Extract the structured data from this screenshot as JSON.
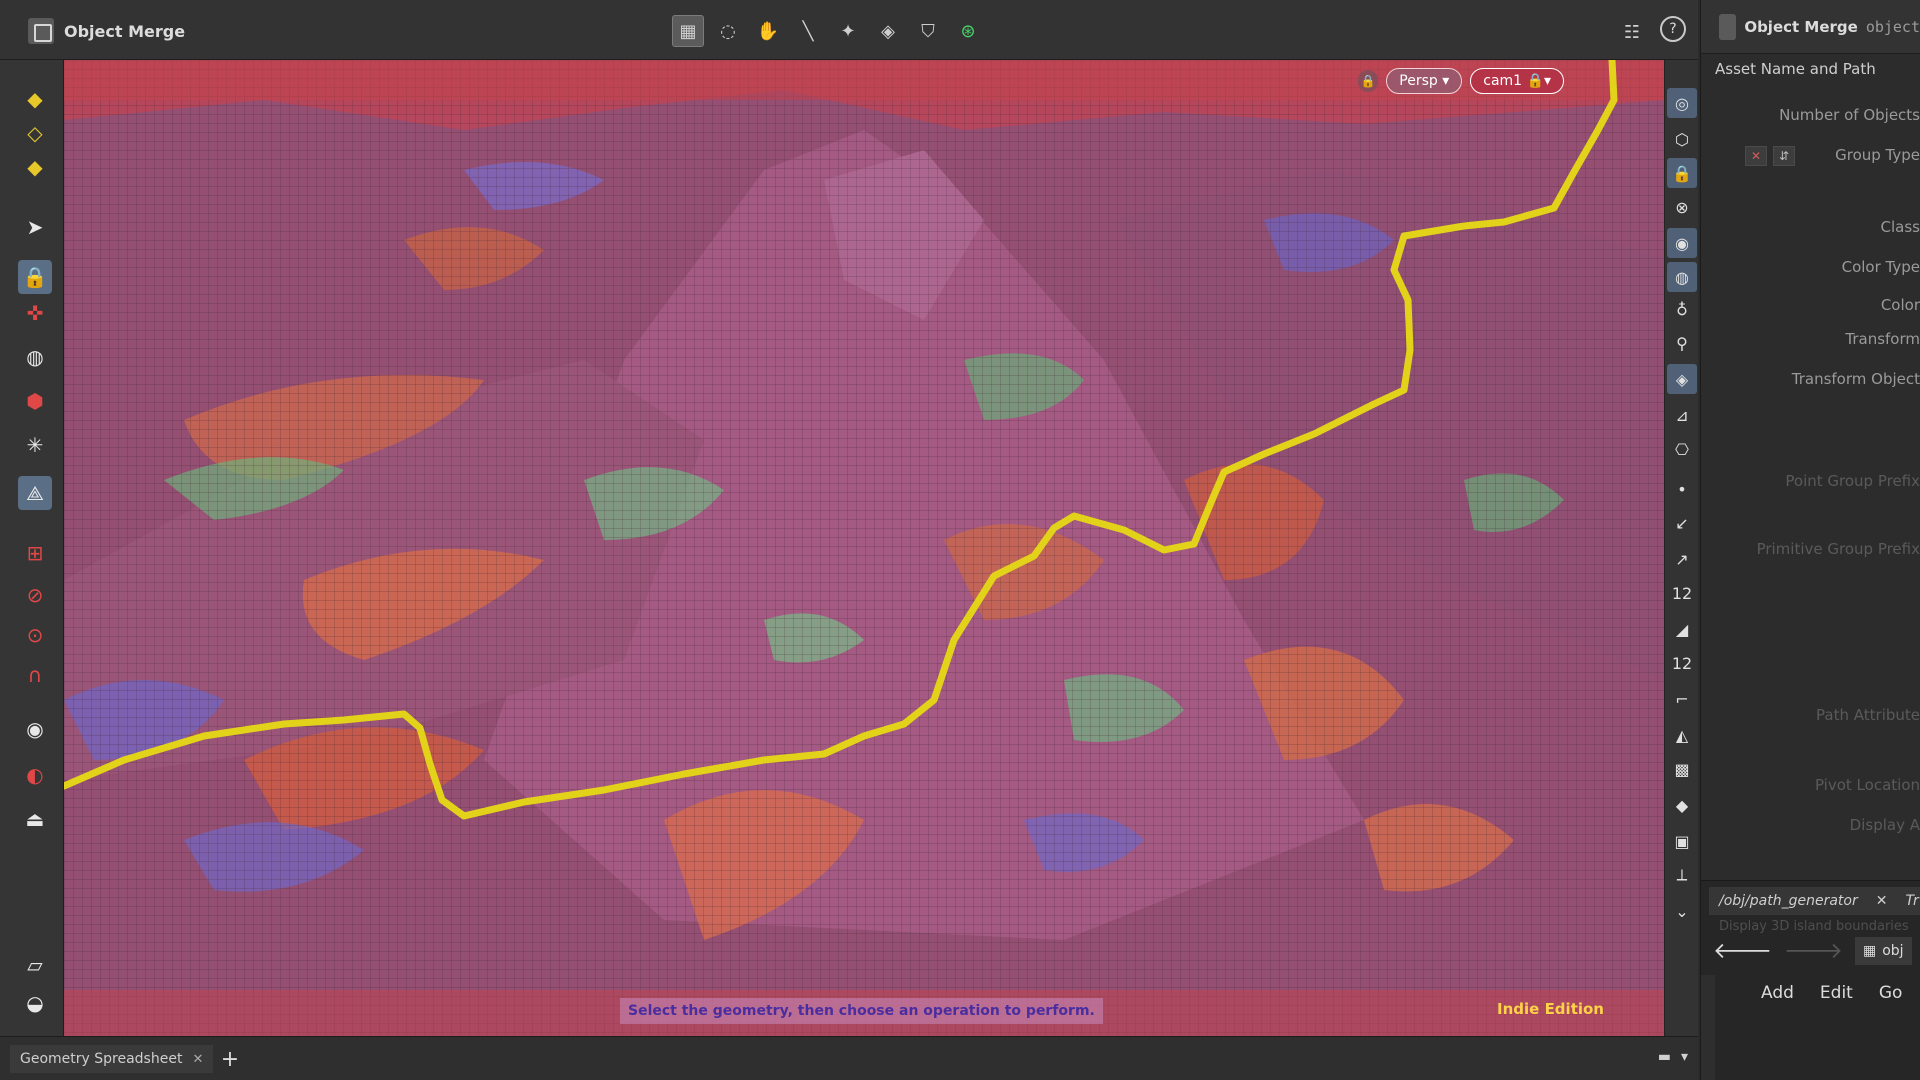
{
  "window": {
    "title": "Object Merge"
  },
  "viewport": {
    "view_mode": "Persp",
    "camera": "cam1",
    "status_message": "Select the geometry, then choose an operation to perform.",
    "edition": "Indie Edition"
  },
  "bottom_pane": {
    "tab_label": "Geometry Spreadsheet"
  },
  "params": {
    "header_title": "Object Merge",
    "header_node": "object",
    "section_label": "Asset Name and Path",
    "fields": [
      {
        "label": "Number of Objects"
      },
      {
        "label": "Group Type"
      },
      {
        "label": "Class"
      },
      {
        "label": "Color Type"
      },
      {
        "label": "Color"
      },
      {
        "label": "Transform"
      },
      {
        "label": "Transform Object"
      },
      {
        "label": "Point Group Prefix"
      },
      {
        "label": "Primitive Group Prefix"
      },
      {
        "label": "Path Attribute"
      },
      {
        "label": "Pivot Location"
      },
      {
        "label": "Display A"
      }
    ]
  },
  "network": {
    "path_tab": "/obj/path_generator",
    "second_tab": "Tr",
    "subtitle": "Display 3D island boundaries",
    "crumb": "obj",
    "menu": [
      "Add",
      "Edit",
      "Go"
    ]
  },
  "colors": {
    "path": "#e2d21a",
    "terrain_base": "#8d4f72",
    "accent": "#5a6e86",
    "edition": "#ffd24a"
  }
}
